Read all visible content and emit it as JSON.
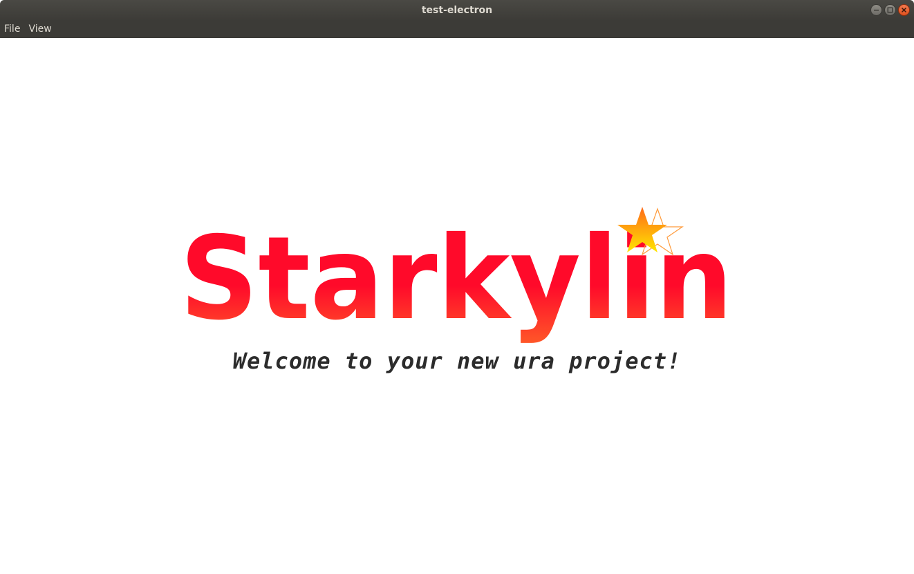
{
  "window": {
    "title": "test-electron"
  },
  "menubar": {
    "items": [
      {
        "label": "File"
      },
      {
        "label": "View"
      }
    ]
  },
  "main": {
    "logo_text": "Starkylin",
    "welcome": "Welcome to your new ura project!"
  },
  "colors": {
    "logo_red": "#ff0a2a",
    "logo_orange": "#ff5a28",
    "star_yellow": "#ffe600",
    "star_orange": "#ff6a1a",
    "titlebar_bg": "#3c3b37",
    "close_button": "#e95420"
  },
  "icons": {
    "minimize": "minimize-icon",
    "maximize": "maximize-icon",
    "close": "close-icon",
    "logo_star": "star-icon"
  }
}
